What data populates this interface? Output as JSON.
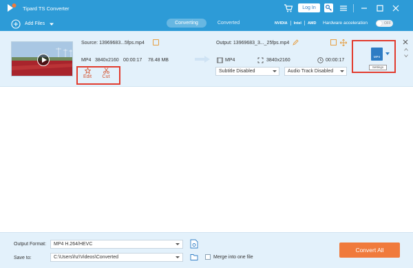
{
  "app": {
    "title": "Tipard TS Converter",
    "login_label": "Log In"
  },
  "toolbar": {
    "add_files_label": "Add Files",
    "tabs": [
      {
        "label": "Converting",
        "active": true
      },
      {
        "label": "Converted",
        "active": false
      }
    ],
    "hw_vendors": [
      "NVIDIA",
      "Intel",
      "AMD"
    ],
    "hw_label": "Hardware acceleration",
    "hw_toggle_text": "OFF"
  },
  "file": {
    "source_name": "Source: 13969683...5fps.mp4",
    "source_format": "MP4",
    "source_resolution": "3840x2160",
    "source_duration": "00:00:17",
    "source_size": "78.48 MB",
    "edit_label": "Edit",
    "cut_label": "Cut",
    "output_name": "Output: 13969683_3..._25fps.mp4",
    "output_format": "MP4",
    "output_resolution": "3840x2160",
    "output_duration": "00:00:17",
    "subtitle_select": "Subtitle Disabled",
    "audio_select": "Audio Track Disabled",
    "profile_icon_text": "MP4",
    "profile_tip": "Settings"
  },
  "bottom": {
    "output_format_label": "Output Format:",
    "output_format_value": "MP4 H.264/HEVC",
    "save_to_label": "Save to:",
    "save_to_value": "C:\\Users\\hz\\Videos\\Converted",
    "merge_label": "Merge into one file",
    "convert_all_label": "Convert All"
  },
  "colors": {
    "accent": "#2d9bd7",
    "highlight_box": "#e23a2c",
    "convert_button": "#f07a3c",
    "row_bg": "#e3f1fb"
  }
}
